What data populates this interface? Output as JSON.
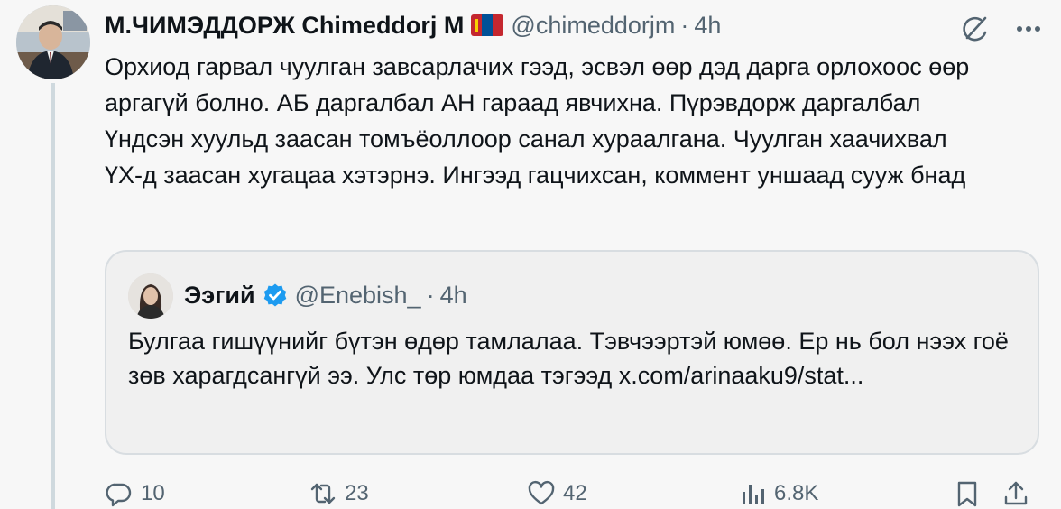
{
  "author": {
    "name": "М.ЧИМЭДДОРЖ Chimeddorj M",
    "handle": "@chimeddorjm",
    "separator": "·",
    "time": "4h"
  },
  "tweet": {
    "text": "Орхиод гарвал чуулган завсарлачих гээд, эсвэл өөр дэд дарга орлохоос өөр аргагүй болно. АБ даргалбал АН гараад явчихна. Пүрэвдорж даргалбал Үндсэн хуульд заасан томъёоллоор санал хураалгана. Чуулган хаачихвал ҮХ-д заасан хугацаа хэтэрнэ. Ингээд гацчихсан, коммент уншаад сууж бнад"
  },
  "quote": {
    "name": "Ээгий",
    "handle": "@Enebish_",
    "separator": "·",
    "time": "4h",
    "text": "Булгаа гишүүнийг бүтэн өдөр тамлалаа. Тэвчээртэй юмөө. Ер нь бол нээх гоё зөв харагдсангүй ээ. Улс төр юмдаа тэгээд x.com/arinaaku9/stat..."
  },
  "actions": {
    "replies": "10",
    "reposts": "23",
    "likes": "42",
    "views": "6.8K"
  },
  "icons": {
    "grok": "grok-icon",
    "more": "more-icon",
    "flag": "mongolia-flag-icon",
    "verified": "verified-badge-icon",
    "reply": "reply-icon",
    "repost": "repost-icon",
    "like": "heart-icon",
    "views": "views-icon",
    "bookmark": "bookmark-icon",
    "share": "share-icon"
  },
  "colors": {
    "text": "#0f1419",
    "secondary": "#536471",
    "verified": "#1d9bf0",
    "border": "#d8dde1",
    "background": "#f7f7f7"
  }
}
